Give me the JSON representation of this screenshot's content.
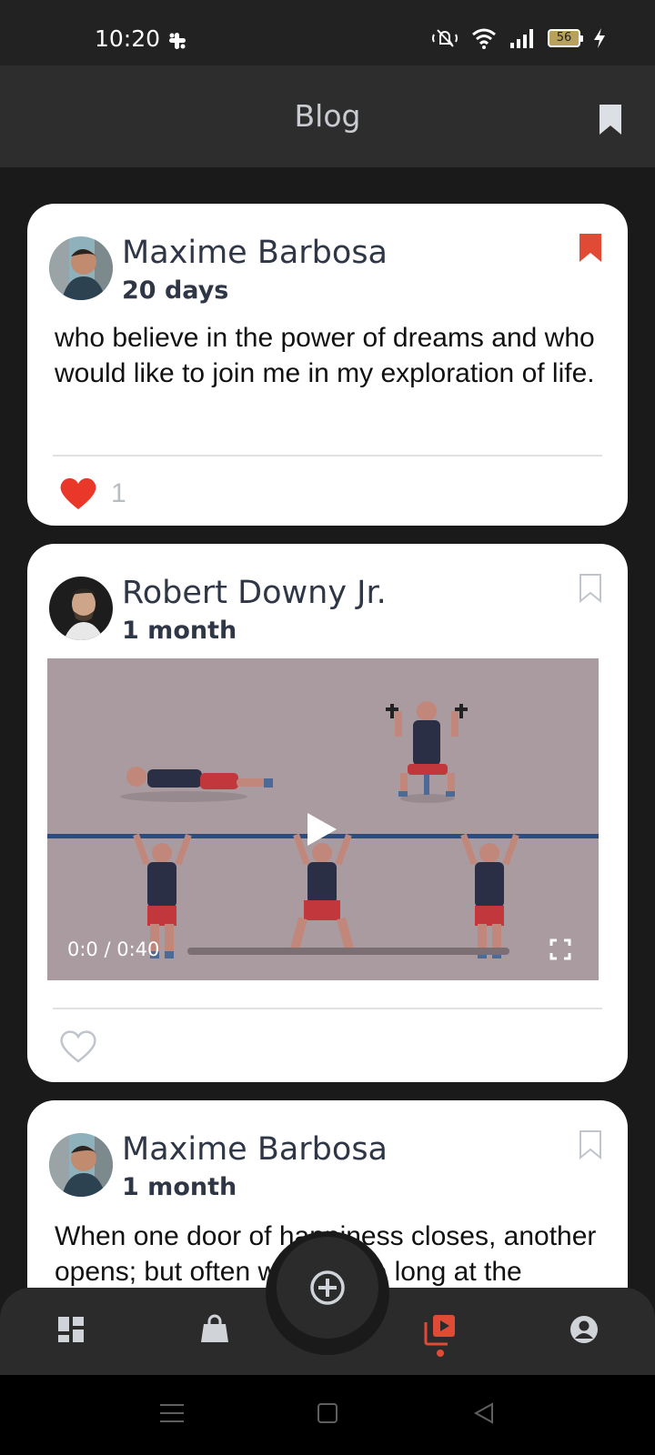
{
  "status_bar": {
    "time": "10:20",
    "battery": "56",
    "icons": [
      "slack-icon",
      "mute-icon",
      "wifi-icon",
      "signal-icon",
      "battery-icon",
      "charging-icon"
    ]
  },
  "header": {
    "title": "Blog",
    "bookmark_icon": "bookmark-icon"
  },
  "posts": [
    {
      "author": "Maxime Barbosa",
      "time": "20 days",
      "text": "who believe in the power of dreams and who would like to join me in my exploration of life.",
      "likes": "1",
      "liked": true,
      "bookmarked": true
    },
    {
      "author": "Robert Downy Jr.",
      "time": "1 month",
      "video": {
        "time_label": "0:0 / 0:40",
        "progress": 0
      },
      "liked": false,
      "bookmarked": false
    },
    {
      "author": "Maxime Barbosa",
      "time": "1 month",
      "text": "When one door of happiness closes, another opens; but often we look so long at the closed door",
      "bookmarked": false
    }
  ],
  "bottom_nav": {
    "items": [
      "dashboard-icon",
      "shop-bag-icon",
      "add-post-icon",
      "video-library-icon",
      "account-icon"
    ],
    "active": "video-library-icon"
  },
  "colors": {
    "accent": "#e14b36",
    "card": "#ffffff",
    "background": "#1a1a1a",
    "text_dark": "#2f3747"
  }
}
